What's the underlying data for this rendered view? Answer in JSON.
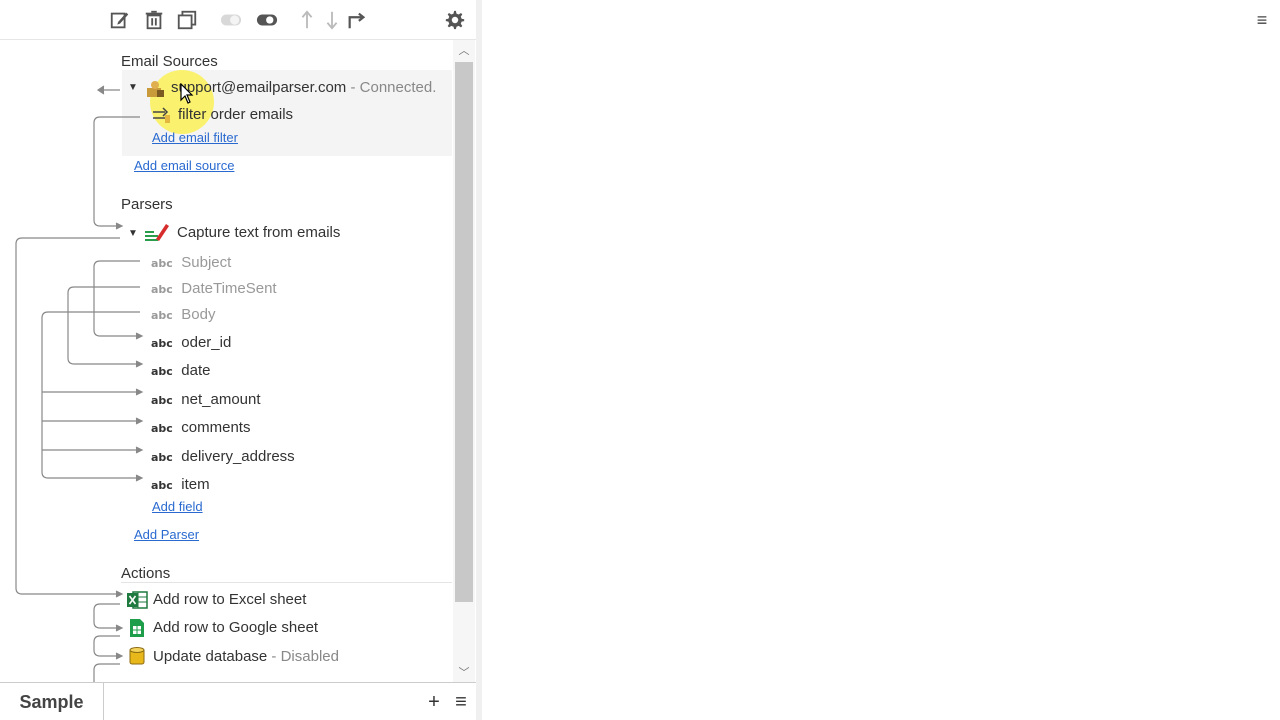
{
  "toolbar": {
    "icons": [
      "edit-icon",
      "delete-icon",
      "copy-icon",
      "toggle-off-icon",
      "toggle-on-icon",
      "arrow-up-icon",
      "arrow-down-icon",
      "redirect-icon",
      "gear-icon"
    ]
  },
  "tree": {
    "email_sources": {
      "title": "Email Sources",
      "source_email": "support@emailparser.com",
      "source_status": " - Connected.",
      "filter_label": "filter order emails",
      "add_filter": "Add email filter",
      "add_source": "Add email source"
    },
    "parsers": {
      "title": "Parsers",
      "parser_label": "Capture text from emails",
      "abc_tag": "abc",
      "fields": [
        {
          "name": "Subject",
          "dim": true
        },
        {
          "name": "DateTimeSent",
          "dim": true
        },
        {
          "name": "Body",
          "dim": true
        },
        {
          "name": "oder_id",
          "dim": false
        },
        {
          "name": "date",
          "dim": false
        },
        {
          "name": "net_amount",
          "dim": false
        },
        {
          "name": "comments",
          "dim": false
        },
        {
          "name": "delivery_address",
          "dim": false
        },
        {
          "name": "item",
          "dim": false
        }
      ],
      "add_field": "Add field",
      "add_parser": "Add Parser"
    },
    "actions": {
      "title": "Actions",
      "items": [
        {
          "label": "Add row to Excel sheet",
          "status": ""
        },
        {
          "label": "Add row to Google sheet",
          "status": ""
        },
        {
          "label": "Update database",
          "status": " - Disabled"
        }
      ]
    }
  },
  "bottom": {
    "tab_label": "Sample"
  },
  "colors": {
    "link": "#2a6ad0",
    "excel_green": "#1f7a3f",
    "sheets_green": "#1e9e4a",
    "db_yellow": "#e8b81a"
  }
}
